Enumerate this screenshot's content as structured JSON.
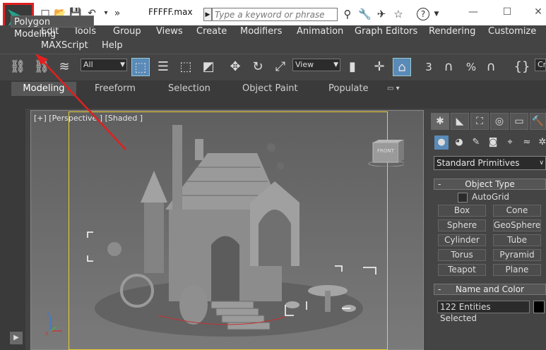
{
  "titlebar": {
    "file_name": "FFFFF.max",
    "search_placeholder": "Type a keyword or phrase",
    "search_arrow": "▶",
    "quick_access": [
      "□",
      "📂",
      "💾",
      "↶",
      "▾",
      "»"
    ],
    "help_icon": "?",
    "controls": [
      "—",
      "☐",
      "✕"
    ]
  },
  "menu": {
    "row1": [
      "Edit",
      "Tools",
      "Group",
      "Views",
      "Create",
      "Modifiers",
      "Animation",
      "Graph Editors",
      "Rendering",
      "Customize"
    ],
    "row2": [
      "MAXScript",
      "Help"
    ]
  },
  "toolbar": {
    "filter_value": "All",
    "coord_value": "View",
    "snap_labels": [
      "3",
      "%"
    ],
    "tail_label": "Cre"
  },
  "ribbon": {
    "tabs": [
      "Modeling",
      "Freeform",
      "Selection",
      "Object Paint",
      "Populate"
    ],
    "panel_label": "Polygon Modeling"
  },
  "viewport": {
    "label": "[+] [Perspective ] [Shaded ]",
    "cube_label": "FRONT"
  },
  "command_panel": {
    "dropdown_value": "Standard Primitives",
    "object_type_title": "Object Type",
    "autogrid_label": "AutoGrid",
    "buttons": [
      "Box",
      "Cone",
      "Sphere",
      "GeoSphere",
      "Cylinder",
      "Tube",
      "Torus",
      "Pyramid",
      "Teapot",
      "Plane"
    ],
    "name_color_title": "Name and Color",
    "selection_text": "122 Entities Selected",
    "swatch_color": "#000000"
  },
  "colors": {
    "accent": "#5a8ab8",
    "highlight_box": "#e02020",
    "safe_frame": "#e8d030"
  }
}
